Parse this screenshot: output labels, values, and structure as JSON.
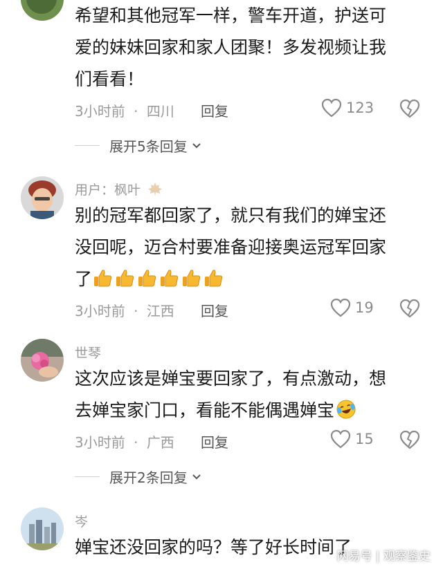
{
  "comments": [
    {
      "username": "",
      "lines": [
        "希望和其他冠军一样，警车开道，护送可",
        "爱的妹妹回家和家人团聚！多发视频让我",
        "们看看！"
      ],
      "time": "3小时前",
      "location": "四川",
      "reply_label": "回复",
      "likes": "123",
      "expand_label": "展开5条回复"
    },
    {
      "username": "用户：枫叶",
      "lines": [
        "别的冠军都回家了，就只有我们的婵宝还",
        "没回呢，迈合村要准备迎接奥运冠军回家",
        "了"
      ],
      "emoji_count": 6,
      "time": "3小时前",
      "location": "江西",
      "reply_label": "回复",
      "likes": "19"
    },
    {
      "username": "世琴",
      "lines": [
        "这次应该是婵宝要回家了，有点激动，想",
        "去婵宝家门口，看能不能偶遇婵宝"
      ],
      "time": "3小时前",
      "location": "广西",
      "reply_label": "回复",
      "likes": "15",
      "expand_label": "展开2条回复"
    },
    {
      "username": "岑",
      "lines": [
        "婵宝还没回家的吗？等了好长时间了"
      ]
    }
  ],
  "meta_separator": "·",
  "watermark": "网易号 | 观察鉴史",
  "icons": {
    "like": "heart-outline-icon",
    "dislike": "broken-heart-icon",
    "expand": "chevron-down-icon",
    "maple": "maple-leaf-icon",
    "thumbs": "thumbs-up-icon",
    "laugh": "laughing-tears-icon"
  }
}
